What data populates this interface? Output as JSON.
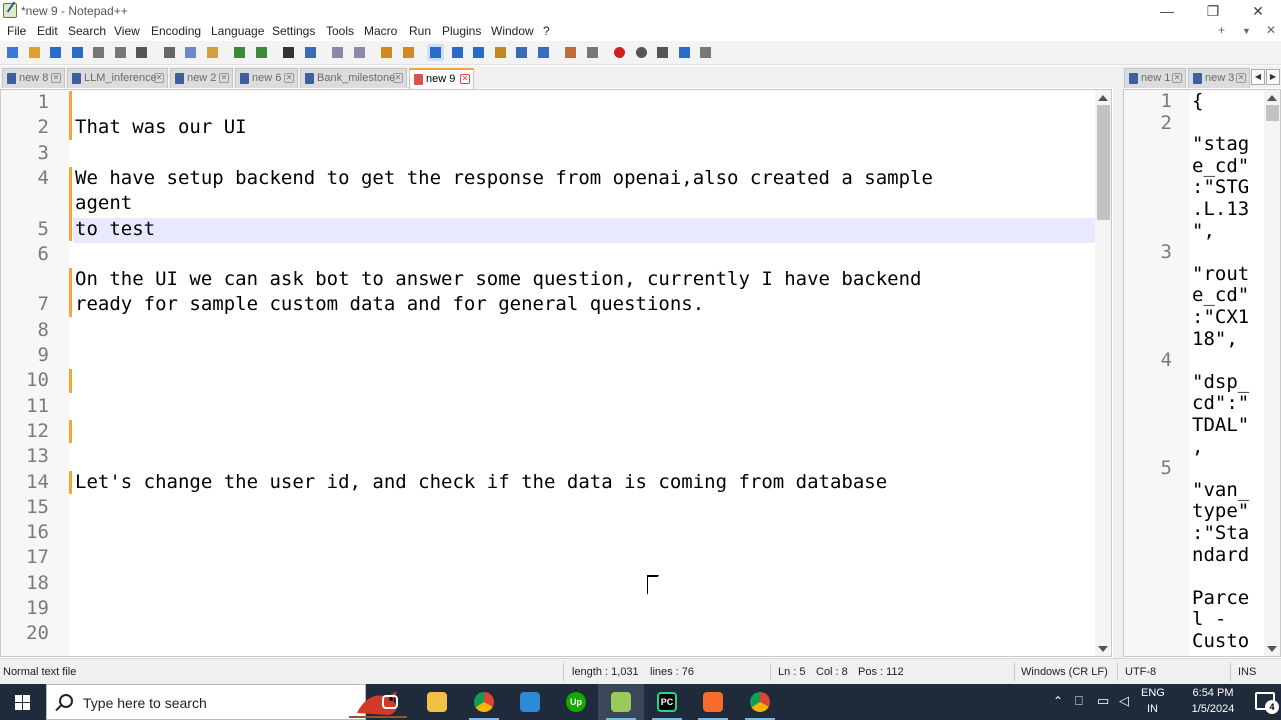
{
  "window": {
    "title": "*new 9 - Notepad++",
    "minimize_glyph": "—",
    "restore_glyph": "❐",
    "close_glyph": "✕"
  },
  "menu": {
    "items": [
      "File",
      "Edit",
      "Search",
      "View",
      "Encoding",
      "Language",
      "Settings",
      "Tools",
      "Macro",
      "Run",
      "Plugins",
      "Window",
      "?"
    ],
    "right": {
      "add": "+",
      "dropdown": "▼",
      "close": "✕"
    }
  },
  "toolbar": {
    "icons": [
      "new-file-icon",
      "open-file-icon",
      "save-icon",
      "save-all-icon",
      "close-icon",
      "close-all-icon",
      "print-icon",
      "cut-icon",
      "copy-icon",
      "paste-icon",
      "undo-icon",
      "redo-icon",
      "find-icon",
      "replace-icon",
      "zoom-in-icon",
      "zoom-out-icon",
      "sync-v-icon",
      "sync-h-icon",
      "word-wrap-icon",
      "show-all-chars-icon",
      "indent-guide-icon",
      "user-lang-icon",
      "doc-map-icon",
      "function-list-icon",
      "folder-workspace-icon",
      "monitor-icon",
      "record-macro-icon",
      "stop-macro-icon",
      "play-macro-icon",
      "run-macro-multiple-icon",
      "save-macro-icon"
    ]
  },
  "tabs_left": [
    {
      "label": "new 8",
      "active": false
    },
    {
      "label": "LLM_inference",
      "active": false
    },
    {
      "label": "new 2",
      "active": false
    },
    {
      "label": "new 6",
      "active": false
    },
    {
      "label": "Bank_milestone",
      "active": false
    },
    {
      "label": "new 9",
      "active": true
    }
  ],
  "tabs_right": [
    {
      "label": "new 1",
      "active": false
    },
    {
      "label": "new 3",
      "active": false
    }
  ],
  "editor_main": {
    "line_numbers": [
      "1",
      "2",
      "3",
      "4",
      "5",
      "6",
      "7",
      "8",
      "9",
      "10",
      "11",
      "12",
      "13",
      "14",
      "15",
      "16",
      "17",
      "18",
      "19",
      "20"
    ],
    "lines": [
      "",
      "That was our UI",
      "",
      "We have setup backend to get the response from openai,also created a sample",
      "agent",
      "to test",
      "",
      "On the UI we can ask bot to answer some question, currently I have backend",
      "ready for sample custom data and for general questions.",
      "",
      "",
      "",
      "",
      "",
      "",
      "Let's change the user id, and check if the data is coming from database"
    ]
  },
  "editor_secondary": {
    "line_numbers": [
      "1",
      "2",
      "3",
      "4",
      "5"
    ],
    "lines": [
      "{",
      "",
      "\"stag",
      "e_cd\"",
      ":\"STG",
      ".L.13",
      "\",",
      "",
      "\"rout",
      "e_cd\"",
      ":\"CX1",
      "18\",",
      "",
      "\"dsp_",
      "cd\":\"",
      "TDAL\"",
      ",",
      "",
      "\"van_",
      "type\"",
      ":\"Sta",
      "ndard",
      "",
      "Parce",
      "l -",
      "Custo"
    ]
  },
  "status": {
    "file_type": "Normal text file",
    "length": "length : 1,031",
    "lines": "lines : 76",
    "ln": "Ln : 5",
    "col": "Col : 8",
    "pos": "Pos : 112",
    "eol": "Windows (CR LF)",
    "encoding": "UTF-8",
    "mode": "INS"
  },
  "taskbar": {
    "search_placeholder": "Type here to search",
    "apps": [
      "task-view-icon",
      "file-explorer-icon",
      "chrome-icon",
      "vscode-icon",
      "upwork-icon",
      "notepadpp-icon",
      "pycharm-icon",
      "xampp-icon",
      "chrome-profile-icon"
    ],
    "upwork_label": "Up",
    "pycharm_label": "PC",
    "tray": {
      "language": "ENG",
      "region": "IN",
      "time": "6:54 PM",
      "date": "1/5/2024",
      "notification_count": "4"
    }
  },
  "colors": {
    "active_tab_accent": "#f4a63a",
    "current_line": "#e8e8ff",
    "change_marker": "#f4a63a",
    "taskbar": "#1f2a3a"
  }
}
